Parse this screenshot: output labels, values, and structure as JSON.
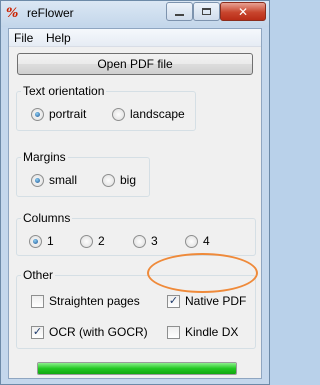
{
  "window": {
    "title": "reFlower",
    "app_icon_glyph": "%"
  },
  "menu": {
    "file": "File",
    "help": "Help"
  },
  "open_button": "Open PDF file",
  "text_orientation": {
    "title": "Text orientation",
    "options": [
      {
        "label": "portrait",
        "selected": true
      },
      {
        "label": "landscape",
        "selected": false
      }
    ]
  },
  "margins": {
    "title": "Margins",
    "options": [
      {
        "label": "small",
        "selected": true
      },
      {
        "label": "big",
        "selected": false
      }
    ]
  },
  "columns": {
    "title": "Columns",
    "options": [
      {
        "label": "1",
        "selected": true
      },
      {
        "label": "2",
        "selected": false
      },
      {
        "label": "3",
        "selected": false
      },
      {
        "label": "4",
        "selected": false
      }
    ]
  },
  "other": {
    "title": "Other",
    "options": [
      {
        "label": "Straighten pages",
        "checked": false
      },
      {
        "label": "Native PDF",
        "checked": true
      },
      {
        "label": "OCR (with GOCR)",
        "checked": true
      },
      {
        "label": "Kindle DX",
        "checked": false
      }
    ]
  },
  "progress": {
    "percent": 100
  },
  "colors": {
    "highlight": "#ef8a3a",
    "progress": "#22c722",
    "close_button": "#c8452d"
  }
}
